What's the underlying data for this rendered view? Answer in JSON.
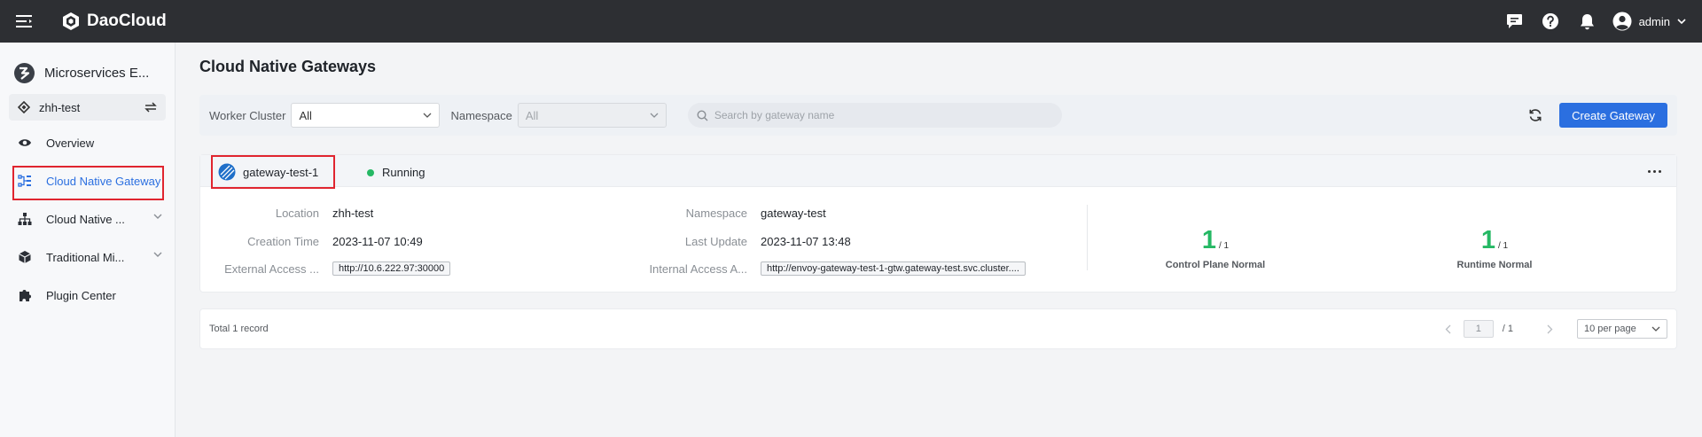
{
  "topbar": {
    "brand": "DaoCloud",
    "user_name": "admin",
    "icons": [
      "menu-icon",
      "message-icon",
      "help-icon",
      "bell-icon",
      "user-avatar-icon",
      "chevron-down-icon"
    ]
  },
  "sidebar": {
    "app_title": "Microservices E...",
    "workspace": "zhh-test",
    "items": [
      {
        "label": "Overview",
        "icon": "eye-icon",
        "active": false
      },
      {
        "label": "Cloud Native Gateway",
        "icon": "gateway-icon",
        "active": true
      },
      {
        "label": "Cloud Native ...",
        "icon": "hierarchy-icon",
        "active": false
      },
      {
        "label": "Traditional Mi...",
        "icon": "cube-icon",
        "active": false
      },
      {
        "label": "Plugin Center",
        "icon": "puzzle-icon",
        "active": false
      }
    ]
  },
  "page": {
    "title": "Cloud Native Gateways"
  },
  "filters": {
    "worker_cluster_label": "Worker Cluster",
    "worker_cluster_value": "All",
    "namespace_label": "Namespace",
    "namespace_value": "All",
    "search_placeholder": "Search by gateway name",
    "create_button": "Create Gateway"
  },
  "gateway": {
    "name": "gateway-test-1",
    "status": "Running",
    "status_color": "#25b864",
    "location_label": "Location",
    "location": "zhh-test",
    "creation_label": "Creation Time",
    "creation_time": "2023-11-07 10:49",
    "external_label": "External Access ...",
    "external_access": "http://10.6.222.97:30000",
    "namespace_label": "Namespace",
    "namespace": "gateway-test",
    "update_label": "Last Update",
    "last_update": "2023-11-07 13:48",
    "internal_label": "Internal Access A...",
    "internal_access": "http://envoy-gateway-test-1-gtw.gateway-test.svc.cluster....",
    "control_plane": {
      "num": "1",
      "den": "/ 1",
      "caption": "Control Plane Normal"
    },
    "runtime": {
      "num": "1",
      "den": "/ 1",
      "caption": "Runtime Normal"
    }
  },
  "pagination": {
    "total": "Total 1 record",
    "current_page": "1",
    "page_count": "/ 1",
    "page_size": "10 per page"
  },
  "colors": {
    "topbar": "#2d2f33",
    "primary": "#2b6fe0",
    "success": "#25b864",
    "highlight": "#e0252f"
  }
}
